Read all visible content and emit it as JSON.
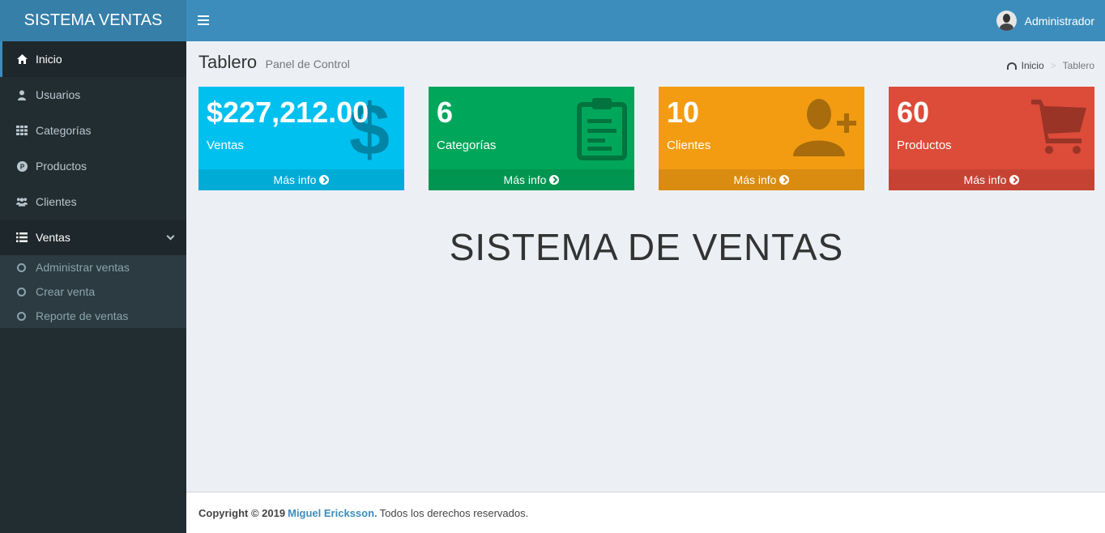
{
  "app": {
    "logo": "SISTEMA VENTAS"
  },
  "header": {
    "user_name": "Administrador"
  },
  "sidebar": {
    "items": [
      {
        "label": "Inicio",
        "icon": "home-icon"
      },
      {
        "label": "Usuarios",
        "icon": "user-icon"
      },
      {
        "label": "Categorías",
        "icon": "grid-icon"
      },
      {
        "label": "Productos",
        "icon": "product-p-icon"
      },
      {
        "label": "Clientes",
        "icon": "users-icon"
      },
      {
        "label": "Ventas",
        "icon": "list-icon"
      }
    ],
    "ventas_sub": [
      {
        "label": "Administrar ventas"
      },
      {
        "label": "Crear venta"
      },
      {
        "label": "Reporte de ventas"
      }
    ]
  },
  "content": {
    "title": "Tablero",
    "subtitle": "Panel de Control",
    "breadcrumb": {
      "home": "Inicio",
      "sep": ">",
      "current": "Tablero"
    },
    "main_title": "SISTEMA DE VENTAS"
  },
  "boxes": [
    {
      "value": "$227,212.00",
      "label": "Ventas",
      "footer": "Más info",
      "color": "#00c0ef",
      "icon": "dollar-icon"
    },
    {
      "value": "6",
      "label": "Categorías",
      "footer": "Más info",
      "color": "#00a65a",
      "icon": "clipboard-icon"
    },
    {
      "value": "10",
      "label": "Clientes",
      "footer": "Más info",
      "color": "#f39c12",
      "icon": "user-add-icon"
    },
    {
      "value": "60",
      "label": "Productos",
      "footer": "Más info",
      "color": "#dd4b39",
      "icon": "cart-icon"
    }
  ],
  "footer": {
    "copyright": "Copyright © 2019",
    "author": "Miguel Ericksson.",
    "rights": "Todos los derechos reservados."
  }
}
